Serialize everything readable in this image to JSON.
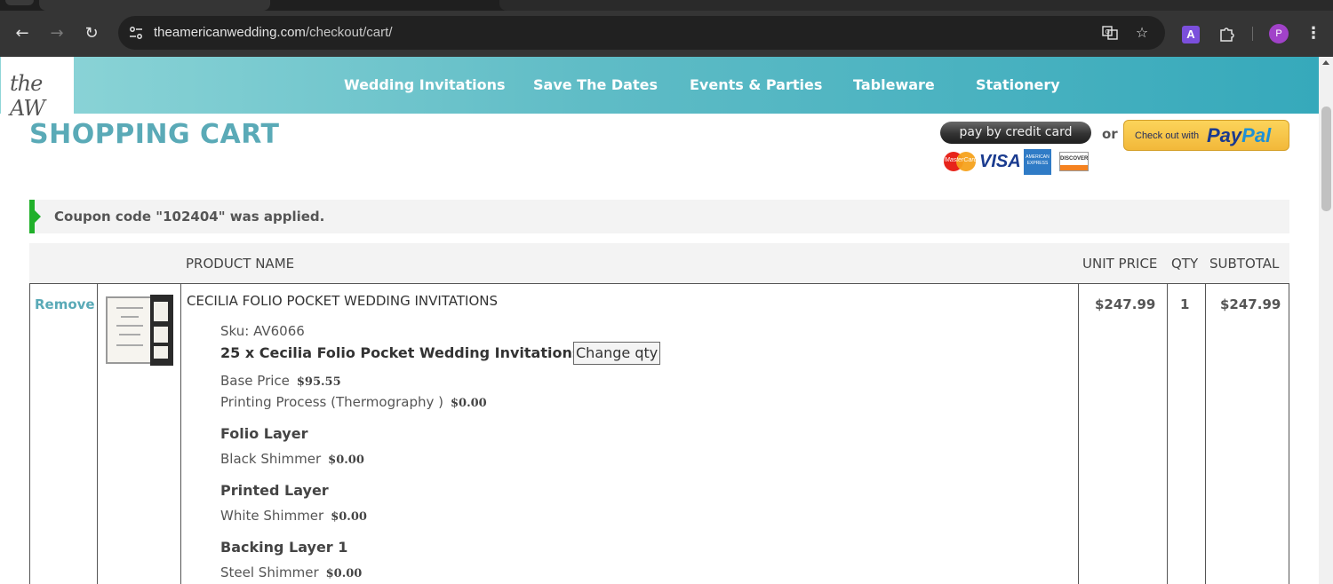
{
  "browser": {
    "url_host": "theamericanwedding.com",
    "url_path": "/checkout/cart/",
    "profile_initial": "P",
    "extension_letter": "A"
  },
  "site": {
    "logo_text": "the AW",
    "nav": [
      "Wedding Invitations",
      "Save The Dates",
      "Events & Parties",
      "Tableware",
      "Stationery"
    ],
    "accent_color": "#5aaab7"
  },
  "cart": {
    "title": "SHOPPING CART",
    "pay_by_card_label": "pay by credit card",
    "or_label": "or",
    "paypal_small": "Check out with",
    "paypal_logo_a": "Pay",
    "paypal_logo_b": "Pal",
    "card_logos": [
      "mastercard-icon",
      "visa-icon",
      "amex-icon",
      "discover-icon"
    ],
    "visa_text": "VISA",
    "mastercard_text": "MasterCard",
    "amex_text": "AMERICAN EXPRESS",
    "discover_text": "DISCOVER",
    "notice": "Coupon code \"102404\" was applied.",
    "columns": {
      "product": "PRODUCT NAME",
      "unit_price": "UNIT PRICE",
      "qty": "QTY",
      "subtotal": "SUBTOTAL"
    },
    "item": {
      "remove_label": "Remove",
      "name": "CECILIA FOLIO POCKET WEDDING INVITATIONS",
      "sku": "Sku: AV6066",
      "qty_line": "25 x Cecilia Folio Pocket Wedding Invitations",
      "change_qty_label": "Change qty",
      "base_price_label": "Base Price",
      "base_price": "$95.55",
      "printing_label": "Printing Process (Thermography )",
      "printing_price": "$0.00",
      "folio_layer_head": "Folio Layer",
      "folio_layer_value": "Black Shimmer",
      "folio_layer_price": "$0.00",
      "printed_layer_head": "Printed Layer",
      "printed_layer_value": "White Shimmer",
      "printed_layer_price": "$0.00",
      "backing_layer_head": "Backing Layer 1",
      "backing_layer_value": "Steel Shimmer",
      "backing_layer_price": "$0.00",
      "unit_price": "$247.99",
      "qty": "1",
      "subtotal": "$247.99"
    }
  }
}
